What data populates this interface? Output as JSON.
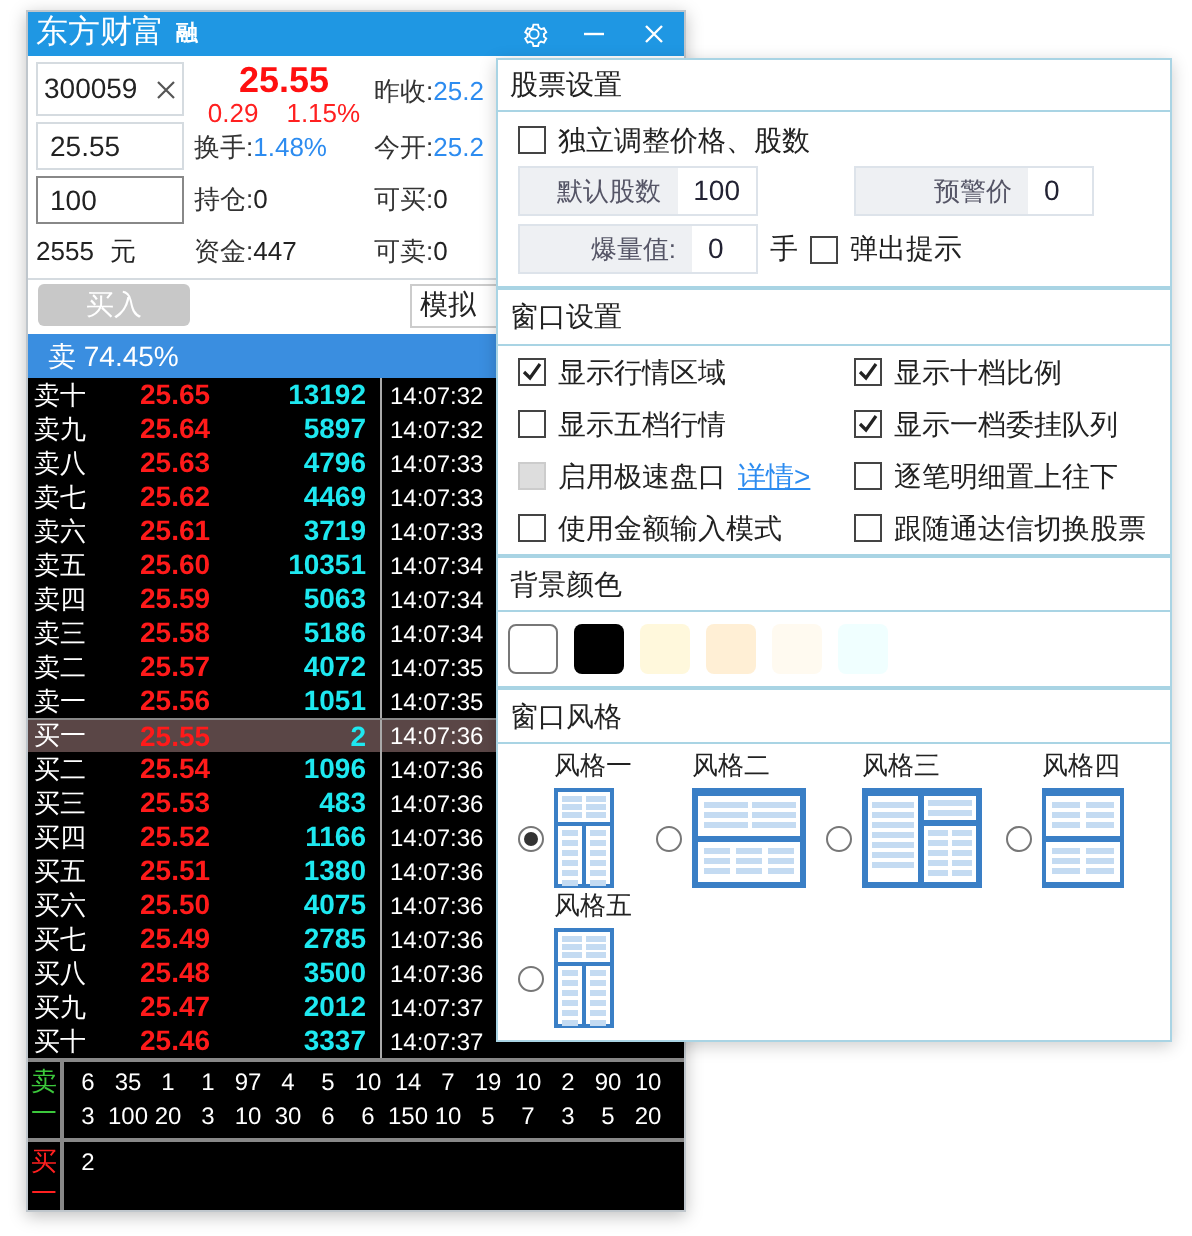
{
  "window": {
    "title": "东方财富",
    "badge": "融"
  },
  "trade": {
    "code": "300059",
    "price": "25.55",
    "change": "0.29",
    "change_pct": "1.15%",
    "price_input": "25.55",
    "qty_input": "100",
    "amount": "2555",
    "amount_unit": "元",
    "middle": [
      {
        "label": "换手:",
        "value": "1.48%",
        "highlighted": true
      },
      {
        "label": "持仓:",
        "value": "0",
        "highlighted": false
      },
      {
        "label": "资金:",
        "value": "447",
        "highlighted": false
      }
    ],
    "right": [
      {
        "label": "昨收:",
        "value": "25.2",
        "highlighted": true
      },
      {
        "label": "今开:",
        "value": "25.2",
        "highlighted": true
      },
      {
        "label": "可买:",
        "value": "0",
        "highlighted": false
      },
      {
        "label": "可卖:",
        "value": "0",
        "highlighted": false
      }
    ],
    "buy_button": {
      "label": "买入",
      "disabled": true
    },
    "mode": "模拟"
  },
  "order_book": {
    "header": "卖 74.45%",
    "levels": [
      {
        "label": "卖十",
        "price": "25.65",
        "volume": "13192",
        "time": "14:07:32",
        "selected": false
      },
      {
        "label": "卖九",
        "price": "25.64",
        "volume": "5897",
        "time": "14:07:32",
        "selected": false
      },
      {
        "label": "卖八",
        "price": "25.63",
        "volume": "4796",
        "time": "14:07:33",
        "selected": false
      },
      {
        "label": "卖七",
        "price": "25.62",
        "volume": "4469",
        "time": "14:07:33",
        "selected": false
      },
      {
        "label": "卖六",
        "price": "25.61",
        "volume": "3719",
        "time": "14:07:33",
        "selected": false
      },
      {
        "label": "卖五",
        "price": "25.60",
        "volume": "10351",
        "time": "14:07:34",
        "selected": false
      },
      {
        "label": "卖四",
        "price": "25.59",
        "volume": "5063",
        "time": "14:07:34",
        "selected": false
      },
      {
        "label": "卖三",
        "price": "25.58",
        "volume": "5186",
        "time": "14:07:34",
        "selected": false
      },
      {
        "label": "卖二",
        "price": "25.57",
        "volume": "4072",
        "time": "14:07:35",
        "selected": false
      },
      {
        "label": "卖一",
        "price": "25.56",
        "volume": "1051",
        "time": "14:07:35",
        "selected": false
      },
      {
        "label": "买一",
        "price": "25.55",
        "volume": "2",
        "time": "14:07:36",
        "selected": true
      },
      {
        "label": "买二",
        "price": "25.54",
        "volume": "1096",
        "time": "14:07:36",
        "selected": false
      },
      {
        "label": "买三",
        "price": "25.53",
        "volume": "483",
        "time": "14:07:36",
        "selected": false
      },
      {
        "label": "买四",
        "price": "25.52",
        "volume": "1166",
        "time": "14:07:36",
        "selected": false
      },
      {
        "label": "买五",
        "price": "25.51",
        "volume": "1380",
        "time": "14:07:36",
        "selected": false
      },
      {
        "label": "买六",
        "price": "25.50",
        "volume": "4075",
        "time": "14:07:36",
        "selected": false
      },
      {
        "label": "买七",
        "price": "25.49",
        "volume": "2785",
        "time": "14:07:36",
        "selected": false
      },
      {
        "label": "买八",
        "price": "25.48",
        "volume": "3500",
        "time": "14:07:36",
        "selected": false
      },
      {
        "label": "买九",
        "price": "25.47",
        "volume": "2012",
        "time": "14:07:37",
        "selected": false
      },
      {
        "label": "买十",
        "price": "25.46",
        "volume": "3337",
        "time": "14:07:37",
        "selected": false
      }
    ]
  },
  "queues": [
    {
      "label": "卖一",
      "kind": "sell",
      "rows": [
        [
          "6",
          "35",
          "1",
          "1",
          "97",
          "4",
          "5",
          "10",
          "14",
          "7",
          "19",
          "10",
          "2",
          "90",
          "10"
        ],
        [
          "3",
          "100",
          "20",
          "3",
          "10",
          "30",
          "6",
          "6",
          "150",
          "10",
          "5",
          "7",
          "3",
          "5",
          "20"
        ]
      ]
    },
    {
      "label": "买一",
      "kind": "buy",
      "rows": [
        [
          "2"
        ]
      ]
    }
  ],
  "settings": {
    "stock": {
      "title": "股票设置",
      "independent": {
        "label": "独立调整价格、股数",
        "checked": false
      },
      "default_shares": {
        "label": "默认股数",
        "value": "100"
      },
      "alert_price": {
        "label": "预警价",
        "value": "0"
      },
      "burst": {
        "label": "爆量值:",
        "value": "0",
        "unit": "手"
      },
      "popup": {
        "label": "弹出提示",
        "checked": false
      }
    },
    "window": {
      "title": "窗口设置",
      "options": [
        {
          "label": "显示行情区域",
          "checked": true,
          "disabled": false
        },
        {
          "label": "显示十档比例",
          "checked": true,
          "disabled": false
        },
        {
          "label": "显示五档行情",
          "checked": false,
          "disabled": false
        },
        {
          "label": "显示一档委挂队列",
          "checked": true,
          "disabled": false
        },
        {
          "label": "启用极速盘口",
          "checked": false,
          "disabled": true,
          "link": "详情>"
        },
        {
          "label": "逐笔明细置上往下",
          "checked": false,
          "disabled": false
        },
        {
          "label": "使用金额输入模式",
          "checked": false,
          "disabled": false
        },
        {
          "label": "跟随通达信切换股票",
          "checked": false,
          "disabled": false
        }
      ]
    },
    "background": {
      "title": "背景颜色",
      "swatches": [
        {
          "color": "#ffffff"
        },
        {
          "color": "#000000"
        },
        {
          "color": "#fff8dc"
        },
        {
          "color": "#ffefd5"
        },
        {
          "color": "#fffaf0"
        },
        {
          "color": "#f0ffff"
        }
      ]
    },
    "style": {
      "title": "窗口风格",
      "styles": [
        {
          "label": "风格一",
          "selected": true,
          "kind": "narrow"
        },
        {
          "label": "风格二",
          "selected": false,
          "kind": "wide"
        },
        {
          "label": "风格三",
          "selected": false,
          "kind": "columns"
        },
        {
          "label": "风格四",
          "selected": false,
          "kind": "square"
        },
        {
          "label": "风格五",
          "selected": false,
          "kind": "tall"
        }
      ]
    }
  }
}
